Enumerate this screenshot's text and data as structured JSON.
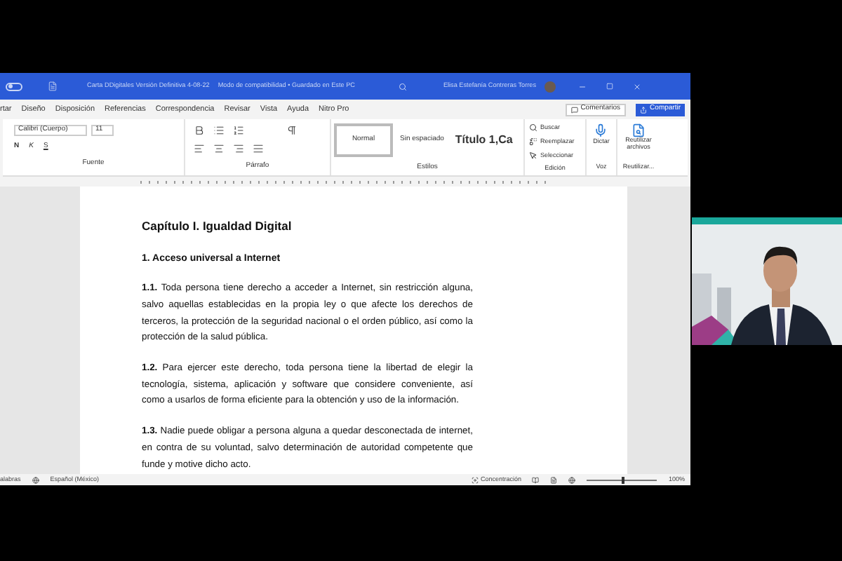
{
  "window": {
    "doc_title": "Carta DDigitales Versión Definitiva 4-08-22",
    "status": "Modo de compatibilidad • Guardado en Este PC",
    "user": "Elisa Estefanía Contreras Torres"
  },
  "tabs": [
    {
      "label": "rtar"
    },
    {
      "label": "Diseño"
    },
    {
      "label": "Disposición"
    },
    {
      "label": "Referencias"
    },
    {
      "label": "Correspondencia"
    },
    {
      "label": "Revisar"
    },
    {
      "label": "Vista"
    },
    {
      "label": "Ayuda"
    },
    {
      "label": "Nitro Pro"
    }
  ],
  "top_buttons": {
    "comments": "Comentarios",
    "share": "Compartir"
  },
  "ribbon": {
    "font_name": "Calibri (Cuerpo)",
    "font_size": "11",
    "format_letters": [
      "N",
      "K",
      "S"
    ],
    "styles": [
      {
        "label": "Normal",
        "selected": true
      },
      {
        "label": "Sin espaciado",
        "selected": false
      },
      {
        "label": "Título 1,Ca",
        "selected": false
      }
    ],
    "editing": [
      "Buscar",
      "Reemplazar",
      "Seleccionar"
    ],
    "dictate": "Dictar",
    "reuse": "Reutilizar archivos",
    "groups": [
      "Fuente",
      "Párrafo",
      "Estilos",
      "Edición",
      "Voz",
      "Reutilizar..."
    ]
  },
  "document": {
    "heading": "Capítulo I. Igualdad Digital",
    "subheading": "1. Acceso universal a Internet",
    "paragraphs": [
      "**1.1.** Toda persona tiene derecho a acceder a Internet, sin restricción alguna, salvo aquellas establecidas en la propia ley o que afecte los derechos de terceros, la protección de la seguridad nacional o el orden público, así como la protección de la salud pública.",
      "**1.2.** Para ejercer este derecho, toda persona tiene la libertad de elegir la tecnología, sistema, aplicación y software que considere conveniente, así como a usarlos de forma eficiente para la obtención y uso de la información.",
      "**1.3.** Nadie puede obligar a persona alguna a quedar desconectada de internet, en contra de su voluntad, salvo determinación de autoridad competente que funde y motive dicho acto."
    ]
  },
  "status_bar": {
    "words": "alabras",
    "language": "Español (México)",
    "focus": "Concentración",
    "zoom": "100%",
    "zoom_slider": {
      "level": 0.5
    }
  },
  "autosave": {
    "on": false
  }
}
